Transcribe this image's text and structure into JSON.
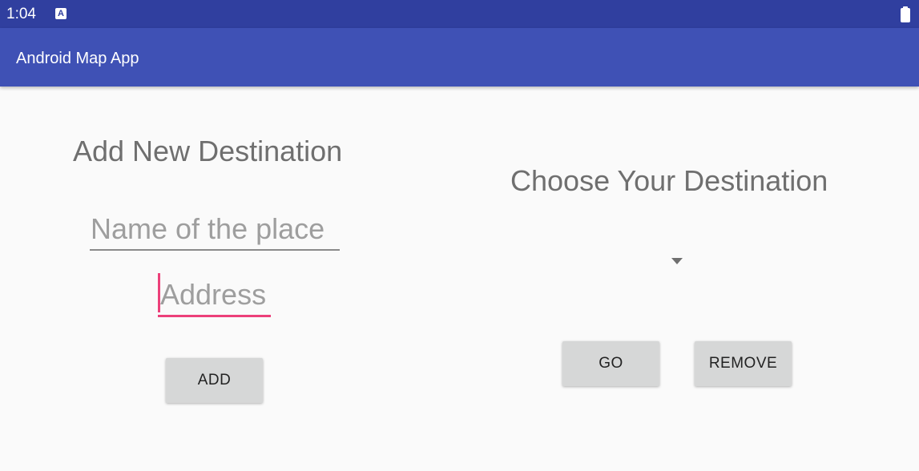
{
  "status_bar": {
    "time": "1:04",
    "notification_icon": "A",
    "battery_icon": "battery-full-icon"
  },
  "app_bar": {
    "title": "Android Map App"
  },
  "add_section": {
    "heading": "Add New Destination",
    "name_placeholder": "Name of the place",
    "address_placeholder": "Address",
    "add_button": "ADD"
  },
  "choose_section": {
    "heading": "Choose Your Destination",
    "spinner_icon": "dropdown-arrow-icon",
    "go_button": "GO",
    "remove_button": "REMOVE"
  },
  "colors": {
    "status_bar": "#303f9f",
    "app_bar": "#3f51b5",
    "accent": "#ec407a",
    "button": "#d6d7d7",
    "background": "#fafafa"
  }
}
